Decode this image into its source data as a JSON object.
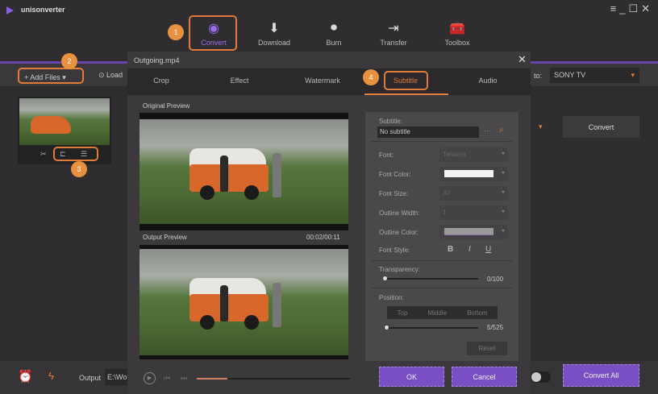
{
  "app": {
    "title": "unisonverter",
    "window_controls": [
      "menu",
      "minimize",
      "maximize",
      "close"
    ]
  },
  "nav": [
    {
      "label": "Convert",
      "icon": "convert-icon",
      "active": true
    },
    {
      "label": "Download",
      "icon": "download-icon"
    },
    {
      "label": "Burn",
      "icon": "burn-icon"
    },
    {
      "label": "Transfer",
      "icon": "transfer-icon"
    },
    {
      "label": "Toolbox",
      "icon": "toolbox-icon"
    }
  ],
  "toolbar": {
    "add_files": "Add Files",
    "load": "Load",
    "convert_to_label": "to:",
    "convert_to_value": "SONY TV"
  },
  "file": {
    "convert_button": "Convert"
  },
  "badges": [
    "1",
    "2",
    "3",
    "4"
  ],
  "dialog": {
    "title": "Outgoing.mp4",
    "tabs": [
      "Crop",
      "Effect",
      "Watermark",
      "Subtitle",
      "Audio"
    ],
    "active_tab": "Subtitle",
    "original_preview": "Original Preview",
    "output_preview": "Output Preview",
    "time": "00:02/00:11",
    "playback_progress": 0.2,
    "subtitle": {
      "label": "Subtitle:",
      "value": "No subtitle",
      "font_label": "Font:",
      "font_value": "Tahoma",
      "font_color_label": "Font Color:",
      "font_color": "#f2f2f2",
      "font_size_label": "Font Size:",
      "font_size_value": "30",
      "outline_width_label": "Outline Width:",
      "outline_width_value": "1",
      "outline_color_label": "Outline Color:",
      "outline_color": "#9a9a9a",
      "font_style_label": "Font Style:",
      "styles": [
        "B",
        "I",
        "U"
      ],
      "transparency_label": "Transparency:",
      "transparency_value": "0/100",
      "transparency": 0,
      "position_label": "Position:",
      "positions": [
        "Top",
        "Middle",
        "Bottom"
      ],
      "position_value": "5/525",
      "position": 0.01,
      "reset": "Reset"
    },
    "ok": "OK",
    "cancel": "Cancel"
  },
  "bottom": {
    "output_label": "Output",
    "output_path": "E:\\Wo",
    "convert_all": "Convert All"
  },
  "colors": {
    "accent": "#7a4fc4",
    "highlight": "#e07b39"
  }
}
